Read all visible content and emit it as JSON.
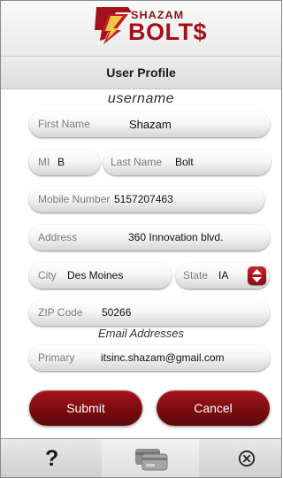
{
  "header": {
    "logo_line1": "SHAZAM",
    "logo_line2": "BOLT$"
  },
  "title": "User Profile",
  "username": "username",
  "fields": {
    "first_name": {
      "label": "First Name",
      "value": "Shazam"
    },
    "mi": {
      "label": "MI",
      "value": "B"
    },
    "last_name": {
      "label": "Last Name",
      "value": "Bolt"
    },
    "mobile": {
      "label": "Mobile Number",
      "value": "5157207463"
    },
    "address": {
      "label": "Address",
      "value": "360 Innovation blvd."
    },
    "city": {
      "label": "City",
      "value": "Des Moines"
    },
    "state": {
      "label": "State",
      "value": "IA"
    },
    "zip": {
      "label": "ZIP Code",
      "value": "50266"
    },
    "email_section": "Email Addresses",
    "primary_email": {
      "label": "Primary",
      "value": "itsinc.shazam@gmail.com"
    }
  },
  "buttons": {
    "submit": "Submit",
    "cancel": "Cancel"
  },
  "tabbar": {
    "help_label": "?",
    "active_tab": "cards",
    "icons": [
      "question-icon",
      "cards-icon",
      "close-circle-icon"
    ]
  },
  "colors": {
    "accent": "#8e0f14",
    "button": "#7a0b10"
  }
}
